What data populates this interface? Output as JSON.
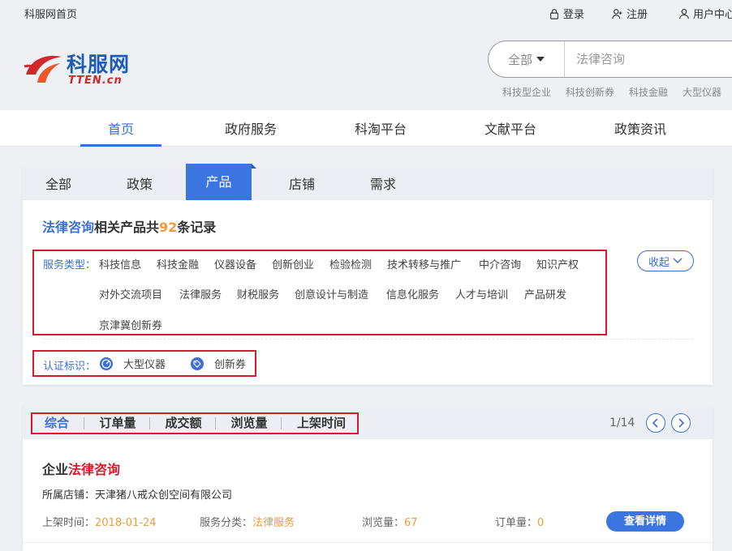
{
  "topbar": {
    "home": "科服网首页",
    "login": "登录",
    "register": "注册",
    "user_center": "用户中心"
  },
  "logo": {
    "cn": "科服网",
    "en": "TTEN.cn"
  },
  "search": {
    "scope": "全部",
    "placeholder": "法律咨询",
    "hotwords": [
      "科技型企业",
      "科技创新券",
      "科技金融",
      "大型仪器"
    ]
  },
  "nav": {
    "items": [
      "首页",
      "政府服务",
      "科淘平台",
      "文献平台",
      "政策资讯"
    ],
    "active": "首页"
  },
  "tabs": {
    "items": [
      "全部",
      "政策",
      "产品",
      "店铺",
      "需求"
    ],
    "active": "产品"
  },
  "result": {
    "keyword": "法律咨询",
    "mid": "相关产品共",
    "count": "92",
    "suffix": "条记录"
  },
  "filters": {
    "service_label": "服务类型：",
    "service_options": [
      "科技信息",
      "科技金融",
      "仪器设备",
      "创新创业",
      "检验检测",
      "技术转移与推广",
      "中介咨询",
      "知识产权",
      "对外交流项目",
      "法律服务",
      "财税服务",
      "创意设计与制造",
      "信息化服务",
      "人才与培训",
      "产品研发",
      "京津冀创新券"
    ],
    "collapse_label": "收起",
    "cert_label": "认证标识：",
    "cert_options": [
      "大型仪器",
      "创新券"
    ]
  },
  "sort": {
    "items": [
      "综合",
      "订单量",
      "成交额",
      "浏览量",
      "上架时间"
    ],
    "active": "综合",
    "page": "1/14"
  },
  "products": [
    {
      "title_prefix": "企业",
      "title_keyword": "法律咨询",
      "shop_label": "所属店铺：",
      "shop": "天津猪八戒众创空间有限公司",
      "date_label": "上架时间：",
      "date": "2018-01-24",
      "category_label": "服务分类：",
      "category": "法律服务",
      "views_label": "浏览量：",
      "views": "67",
      "orders_label": "订单量：",
      "orders": "0",
      "detail_label": "查看详情"
    }
  ],
  "colors": {
    "accent": "#3a6fd8",
    "highlight": "#f29a3a",
    "keyword_red": "#d9192b",
    "annotation_red": "#d9192b"
  }
}
